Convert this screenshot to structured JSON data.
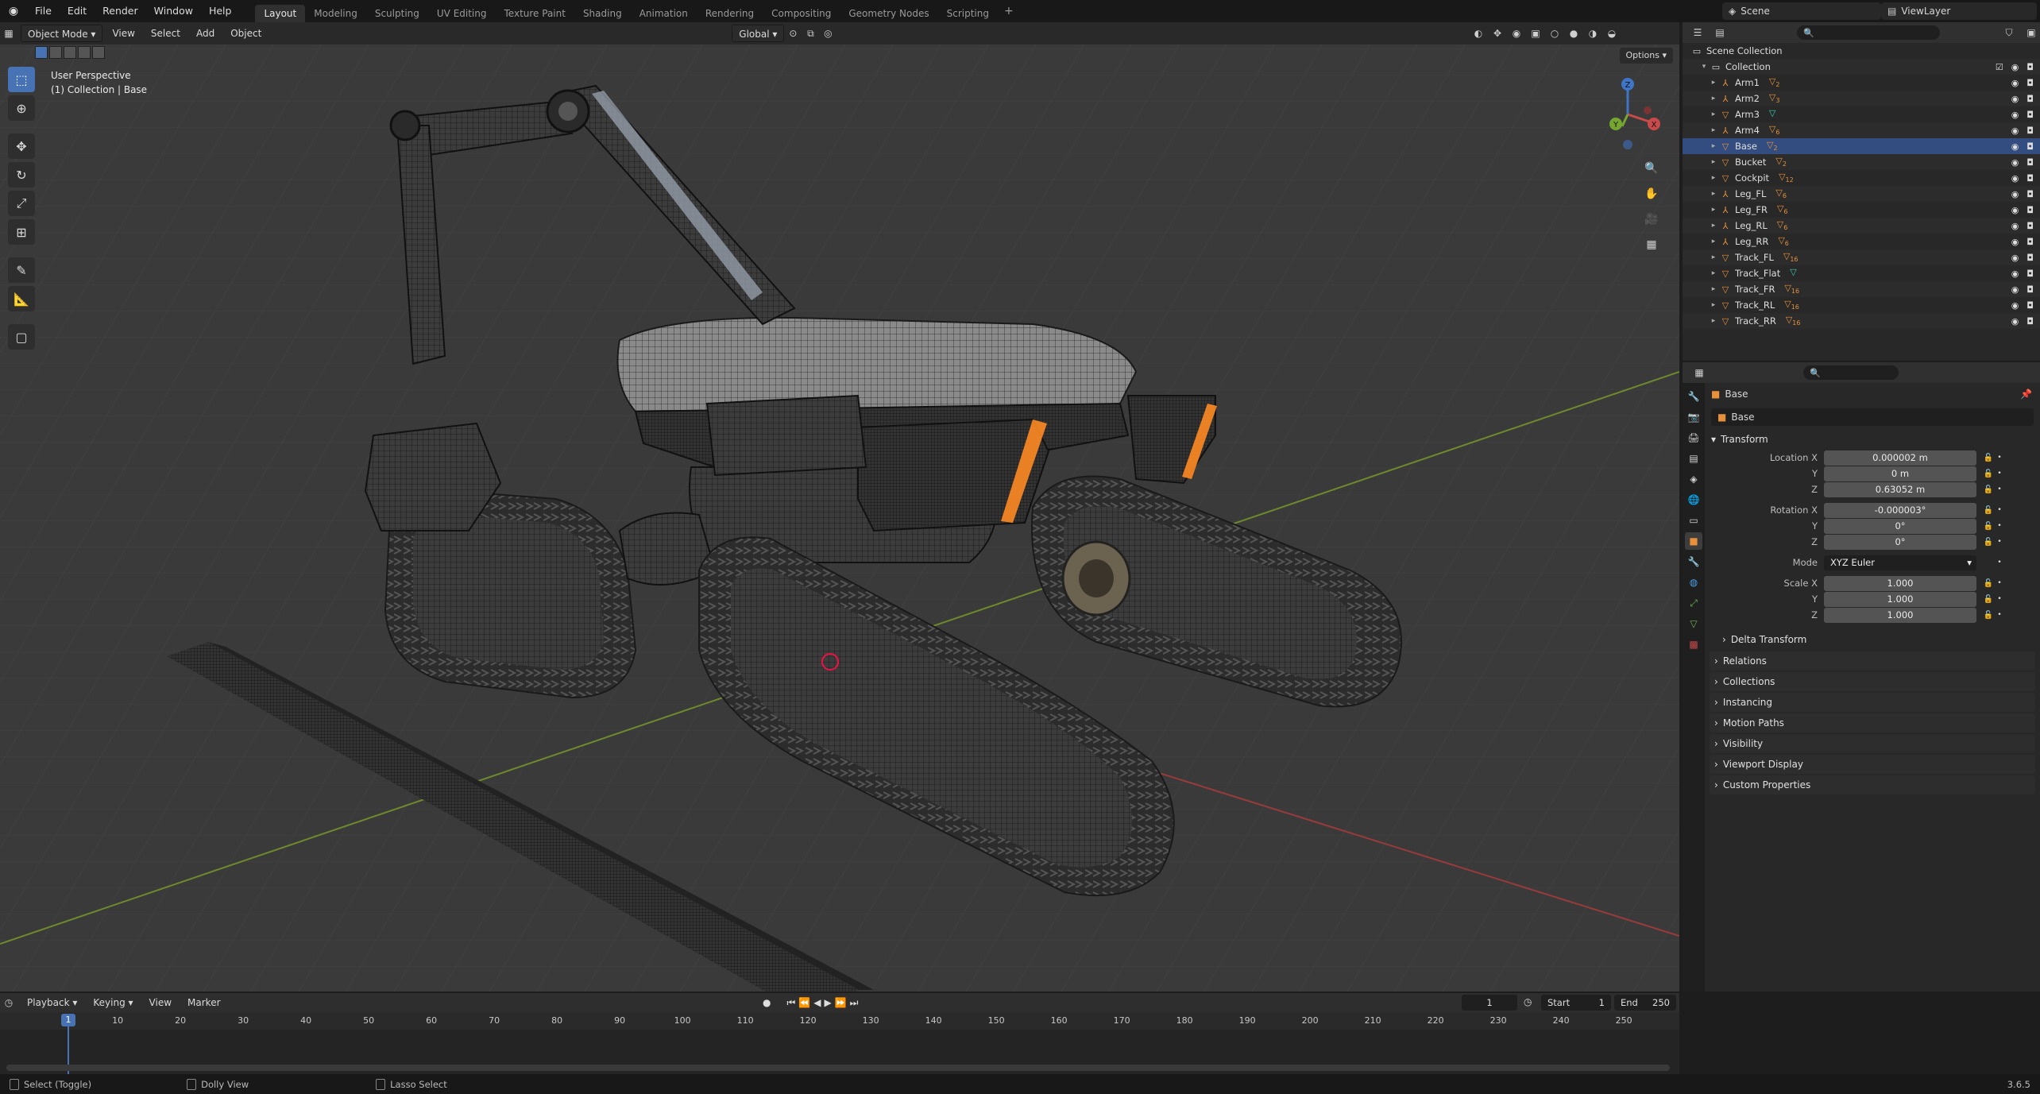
{
  "topbar": {
    "menus": [
      "File",
      "Edit",
      "Render",
      "Window",
      "Help"
    ],
    "workspaces": [
      "Layout",
      "Modeling",
      "Sculpting",
      "UV Editing",
      "Texture Paint",
      "Shading",
      "Animation",
      "Rendering",
      "Compositing",
      "Geometry Nodes",
      "Scripting"
    ],
    "active_workspace": "Layout",
    "scene": "Scene",
    "view_layer": "ViewLayer"
  },
  "viewport": {
    "mode": "Object Mode",
    "menus": [
      "View",
      "Select",
      "Add",
      "Object"
    ],
    "orientation": "Global",
    "options": "Options",
    "info_line1": "User Perspective",
    "info_line2": "(1) Collection | Base",
    "gizmo_axes": [
      "X",
      "Y",
      "Z"
    ]
  },
  "outliner": {
    "root": "Scene Collection",
    "collection": "Collection",
    "items": [
      {
        "name": "Arm1",
        "icon": "bone",
        "mod": "▽",
        "mod_sub": "2"
      },
      {
        "name": "Arm2",
        "icon": "bone",
        "mod": "▽",
        "mod_sub": "3"
      },
      {
        "name": "Arm3",
        "icon": "mesh",
        "mod": "▽",
        "mod_sub": ""
      },
      {
        "name": "Arm4",
        "icon": "bone",
        "mod": "▽",
        "mod_sub": "6"
      },
      {
        "name": "Base",
        "icon": "mesh",
        "mod": "▽",
        "mod_sub": "2"
      },
      {
        "name": "Bucket",
        "icon": "mesh",
        "mod": "▽",
        "mod_sub": "2"
      },
      {
        "name": "Cockpit",
        "icon": "mesh",
        "mod": "▽",
        "mod_sub": "12"
      },
      {
        "name": "Leg_FL",
        "icon": "bone",
        "mod": "▽",
        "mod_sub": "6"
      },
      {
        "name": "Leg_FR",
        "icon": "bone",
        "mod": "▽",
        "mod_sub": "6"
      },
      {
        "name": "Leg_RL",
        "icon": "bone",
        "mod": "▽",
        "mod_sub": "6"
      },
      {
        "name": "Leg_RR",
        "icon": "bone",
        "mod": "▽",
        "mod_sub": "6"
      },
      {
        "name": "Track_FL",
        "icon": "mesh",
        "mod": "▽",
        "mod_sub": "16"
      },
      {
        "name": "Track_Flat",
        "icon": "mesh",
        "mod": "▽",
        "mod_sub": ""
      },
      {
        "name": "Track_FR",
        "icon": "mesh",
        "mod": "▽",
        "mod_sub": "16"
      },
      {
        "name": "Track_RL",
        "icon": "mesh",
        "mod": "▽",
        "mod_sub": "16"
      },
      {
        "name": "Track_RR",
        "icon": "mesh",
        "mod": "▽",
        "mod_sub": "16"
      }
    ]
  },
  "properties": {
    "object_name": "Base",
    "data_name": "Base",
    "transform_label": "Transform",
    "location": {
      "label": "Location X",
      "x": "0.000002 m",
      "y": "0 m",
      "z": "0.63052 m"
    },
    "rotation": {
      "label": "Rotation X",
      "x": "-0.000003°",
      "y": "0°",
      "z": "0°"
    },
    "mode": {
      "label": "Mode",
      "value": "XYZ Euler"
    },
    "scale": {
      "label": "Scale X",
      "x": "1.000",
      "y": "1.000",
      "z": "1.000"
    },
    "axis_y": "Y",
    "axis_z": "Z",
    "delta": "Delta Transform",
    "panels": [
      "Relations",
      "Collections",
      "Instancing",
      "Motion Paths",
      "Visibility",
      "Viewport Display",
      "Custom Properties"
    ]
  },
  "timeline": {
    "menus": [
      "Playback",
      "Keying",
      "View",
      "Marker"
    ],
    "current_frame": "1",
    "start_label": "Start",
    "start": "1",
    "end_label": "End",
    "end": "250",
    "ticks": [
      "10",
      "20",
      "30",
      "40",
      "50",
      "60",
      "70",
      "80",
      "90",
      "100",
      "110",
      "120",
      "130",
      "140",
      "150",
      "160",
      "170",
      "180",
      "190",
      "200",
      "210",
      "220",
      "230",
      "240",
      "250"
    ]
  },
  "statusbar": {
    "hint1": "Select (Toggle)",
    "hint2": "Dolly View",
    "hint3": "Lasso Select",
    "version": "3.6.5"
  },
  "colors": {
    "accent": "#4772b3",
    "axis_x": "#c94a4a",
    "axis_y": "#76a630",
    "axis_z": "#3f75c7",
    "modifier": "#e8913a",
    "glow": "#ff8a24"
  }
}
